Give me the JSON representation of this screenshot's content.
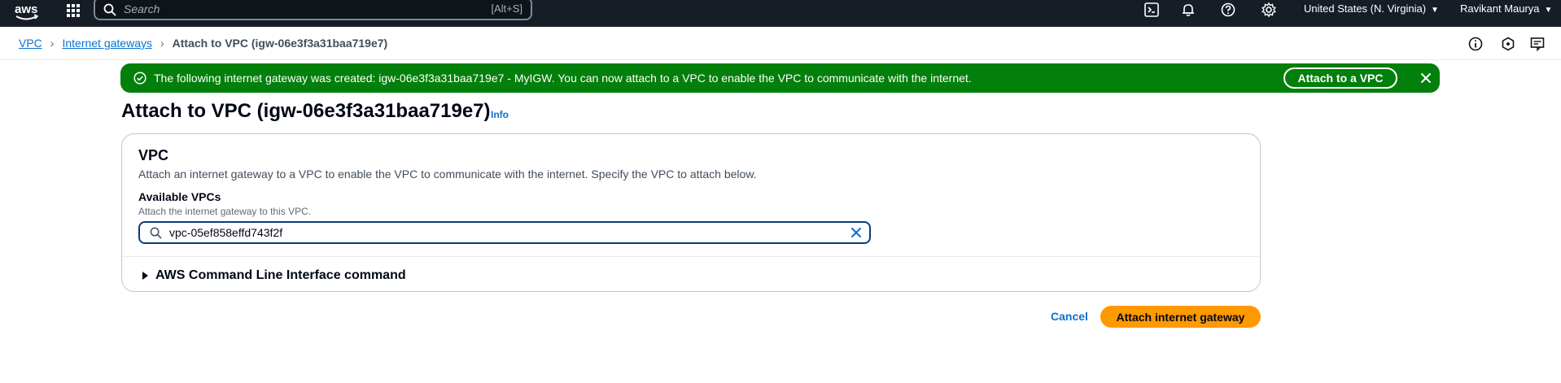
{
  "topnav": {
    "search_placeholder": "Search",
    "search_shortcut": "[Alt+S]",
    "region": "United States (N. Virginia)",
    "user": "Ravikant Maurya",
    "icons": [
      "aws-logo",
      "services-grid-icon",
      "cloudshell-icon",
      "notifications-icon",
      "help-icon",
      "settings-icon"
    ]
  },
  "breadcrumb": {
    "items": [
      "VPC",
      "Internet gateways"
    ],
    "current": "Attach to VPC (igw-06e3f3a31baa719e7)"
  },
  "flash": {
    "message": "The following internet gateway was created: igw-06e3f3a31baa719e7 - MyIGW. You can now attach to a VPC to enable the VPC to communicate with the internet.",
    "action_label": "Attach to a VPC",
    "color": "#037f0c"
  },
  "page": {
    "title": "Attach to VPC (igw-06e3f3a31baa719e7)",
    "info_label": "Info"
  },
  "vpc_section": {
    "heading": "VPC",
    "description": "Attach an internet gateway to a VPC to enable the VPC to communicate with the internet. Specify the VPC to attach below.",
    "field_label": "Available VPCs",
    "field_description": "Attach the internet gateway to this VPC.",
    "field_value": "vpc-05ef858effd743f2f",
    "expander_label": "AWS Command Line Interface command"
  },
  "actions": {
    "cancel_label": "Cancel",
    "submit_label": "Attach internet gateway",
    "accent_color": "#ff9900"
  }
}
